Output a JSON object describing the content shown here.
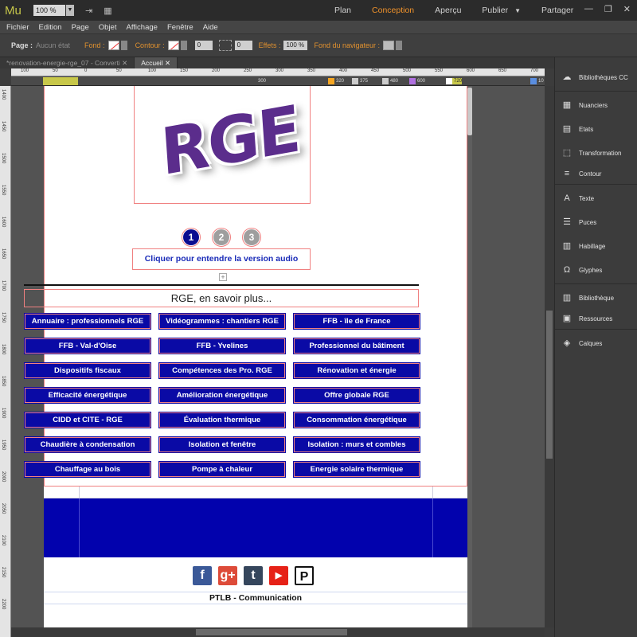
{
  "app": {
    "logo": "Mu",
    "zoom": "100 %",
    "modes": [
      "Plan",
      "Conception",
      "Aperçu",
      "Publier",
      "Partager"
    ],
    "active_mode": "Conception",
    "publish_arrow": "▼"
  },
  "menu": [
    "Fichier",
    "Edition",
    "Page",
    "Objet",
    "Affichage",
    "Fenêtre",
    "Aide"
  ],
  "controlbar": {
    "page_label": "Page :",
    "state": "Aucun état",
    "fill_label": "Fond :",
    "stroke_label": "Contour :",
    "stroke_value": "0",
    "spacing_value": "0",
    "effects_label": "Effets :",
    "opacity_value": "100 %",
    "browser_fill_label": "Fond du navigateur :"
  },
  "tabs": [
    "*renovation-energie-rge_07 - Converti",
    "Accueil"
  ],
  "ruler": {
    "top_labels": [
      "100",
      "50",
      "0",
      "50",
      "100",
      "150",
      "200",
      "250",
      "300",
      "350",
      "400",
      "450",
      "500",
      "550",
      "600",
      "650",
      "700"
    ],
    "side_labels": [
      "1400",
      "1450",
      "1500",
      "1550",
      "1600",
      "1650",
      "1700",
      "1750",
      "1800",
      "1850",
      "1900",
      "1950",
      "2000",
      "2050",
      "2100",
      "2150",
      "2200"
    ]
  },
  "breakpoints": [
    {
      "label": "300",
      "color": "#4a4a4a"
    },
    {
      "label": "320",
      "color": "#f5a623"
    },
    {
      "label": "375",
      "color": "#cccccc"
    },
    {
      "label": "480",
      "color": "#cccccc"
    },
    {
      "label": "600",
      "color": "#b070e0"
    },
    {
      "label": "720",
      "color": "#ffffff"
    },
    {
      "label": "10",
      "color": "#5a8ee0"
    }
  ],
  "page": {
    "logo_text": "RGE",
    "steps": [
      "1",
      "2",
      "3"
    ],
    "audio_button": "Cliquer pour entendre la version audio",
    "section_title": "RGE, en savoir plus...",
    "links": [
      "Annuaire : professionnels RGE",
      "Vidéogrammes : chantiers RGE",
      "FFB - île de France",
      "FFB - Val-d'Oise",
      "FFB - Yvelines",
      "Professionnel du bâtiment",
      "Dispositifs fiscaux",
      "Compétences des Pro. RGE",
      "Rénovation et énergie",
      "Efficacité énergétique",
      "Amélioration énergétique",
      "Offre globale RGE",
      "CIDD et CITE  - RGE",
      "Évaluation thermique",
      "Consommation énergétique",
      "Chaudière à condensation",
      "Isolation et fenêtre",
      "Isolation : murs et combles",
      "Chauffage au bois",
      "Pompe à chaleur",
      "Energie solaire thermique"
    ],
    "socials": [
      {
        "name": "facebook",
        "glyph": "f"
      },
      {
        "name": "google-plus",
        "glyph": "g+"
      },
      {
        "name": "tumblr",
        "glyph": "t"
      },
      {
        "name": "youtube",
        "glyph": "▶"
      },
      {
        "name": "p-logo",
        "glyph": "P"
      }
    ],
    "footer_text": "PTLB - Communication"
  },
  "panels": [
    "Bibliothèques CC",
    "Nuanciers",
    "Etats",
    "Transformation",
    "Contour",
    "Texte",
    "Puces",
    "Habillage",
    "Glyphes",
    "Bibliothèque",
    "Ressources",
    "Calques"
  ]
}
